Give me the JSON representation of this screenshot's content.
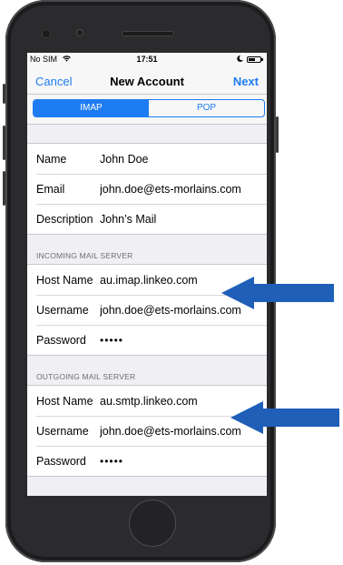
{
  "status_bar": {
    "carrier": "No SIM",
    "wifi_icon": "wifi-icon",
    "time": "17:51",
    "moon_icon": "moon-icon",
    "battery_icon": "battery-icon"
  },
  "nav": {
    "cancel_label": "Cancel",
    "title": "New Account",
    "next_label": "Next"
  },
  "segmented": {
    "options": [
      "IMAP",
      "POP"
    ],
    "selected": "IMAP"
  },
  "account": {
    "rows": [
      {
        "label": "Name",
        "value": "John Doe"
      },
      {
        "label": "Email",
        "value": "john.doe@ets-morlains.com"
      },
      {
        "label": "Description",
        "value": "John’s Mail"
      }
    ]
  },
  "incoming": {
    "header": "INCOMING MAIL SERVER",
    "rows": [
      {
        "label": "Host Name",
        "value": "au.imap.linkeo.com"
      },
      {
        "label": "Username",
        "value": "john.doe@ets-morlains.com"
      },
      {
        "label": "Password",
        "value": "•••••"
      }
    ]
  },
  "outgoing": {
    "header": "OUTGOING MAIL SERVER",
    "rows": [
      {
        "label": "Host Name",
        "value": "au.smtp.linkeo.com"
      },
      {
        "label": "Username",
        "value": "john.doe@ets-morlains.com"
      },
      {
        "label": "Password",
        "value": "•••••"
      }
    ]
  },
  "colors": {
    "accent": "#1e7cf2",
    "arrow": "#1f5fb8",
    "phone_body": "#2b2b2d"
  }
}
